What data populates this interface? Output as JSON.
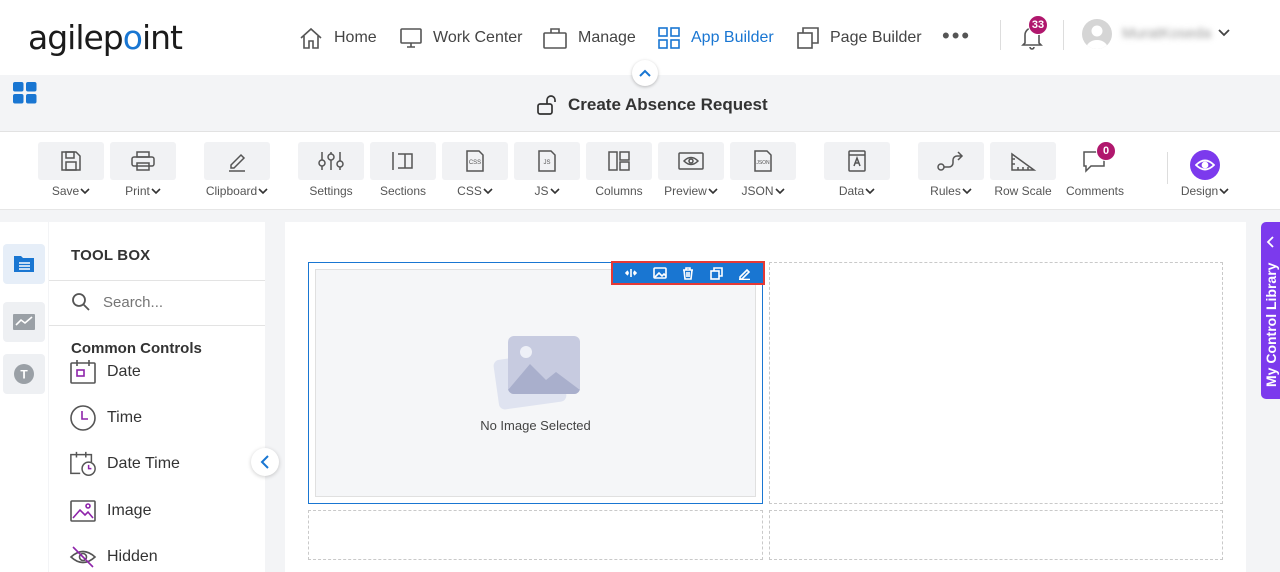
{
  "brand": {
    "logo_text_a": "agilep",
    "logo_text_b": "o",
    "logo_text_c": "int"
  },
  "nav": {
    "home": "Home",
    "work_center": "Work Center",
    "manage": "Manage",
    "app_builder": "App Builder",
    "page_builder": "Page Builder",
    "more": "•••"
  },
  "notifications": {
    "count": "33"
  },
  "user": {
    "name": "MuratKoseda"
  },
  "page": {
    "title": "Create Absence Request"
  },
  "toolbar": {
    "save": "Save",
    "print": "Print",
    "clipboard": "Clipboard",
    "settings": "Settings",
    "sections": "Sections",
    "css": "CSS",
    "js": "JS",
    "columns": "Columns",
    "preview": "Preview",
    "json": "JSON",
    "data": "Data",
    "rules": "Rules",
    "row_scale": "Row Scale",
    "comments": "Comments",
    "comments_count": "0",
    "design": "Design",
    "css_icon_text": "CSS",
    "js_icon_text": "JS",
    "json_icon_text": "JSON"
  },
  "toolbox": {
    "title": "TOOL BOX",
    "search_placeholder": "Search...",
    "section": "Common Controls",
    "items": [
      {
        "label": "Date"
      },
      {
        "label": "Time"
      },
      {
        "label": "Date Time"
      },
      {
        "label": "Image"
      },
      {
        "label": "Hidden"
      }
    ]
  },
  "rail": {
    "third_icon_letter": "T"
  },
  "canvas": {
    "image_caption": "No Image Selected"
  },
  "library_tab": {
    "label": "My Control Library"
  },
  "colors": {
    "accent": "#1976d2",
    "purple": "#7c3aed",
    "badge": "#b0176d",
    "highlight": "#e53935"
  }
}
